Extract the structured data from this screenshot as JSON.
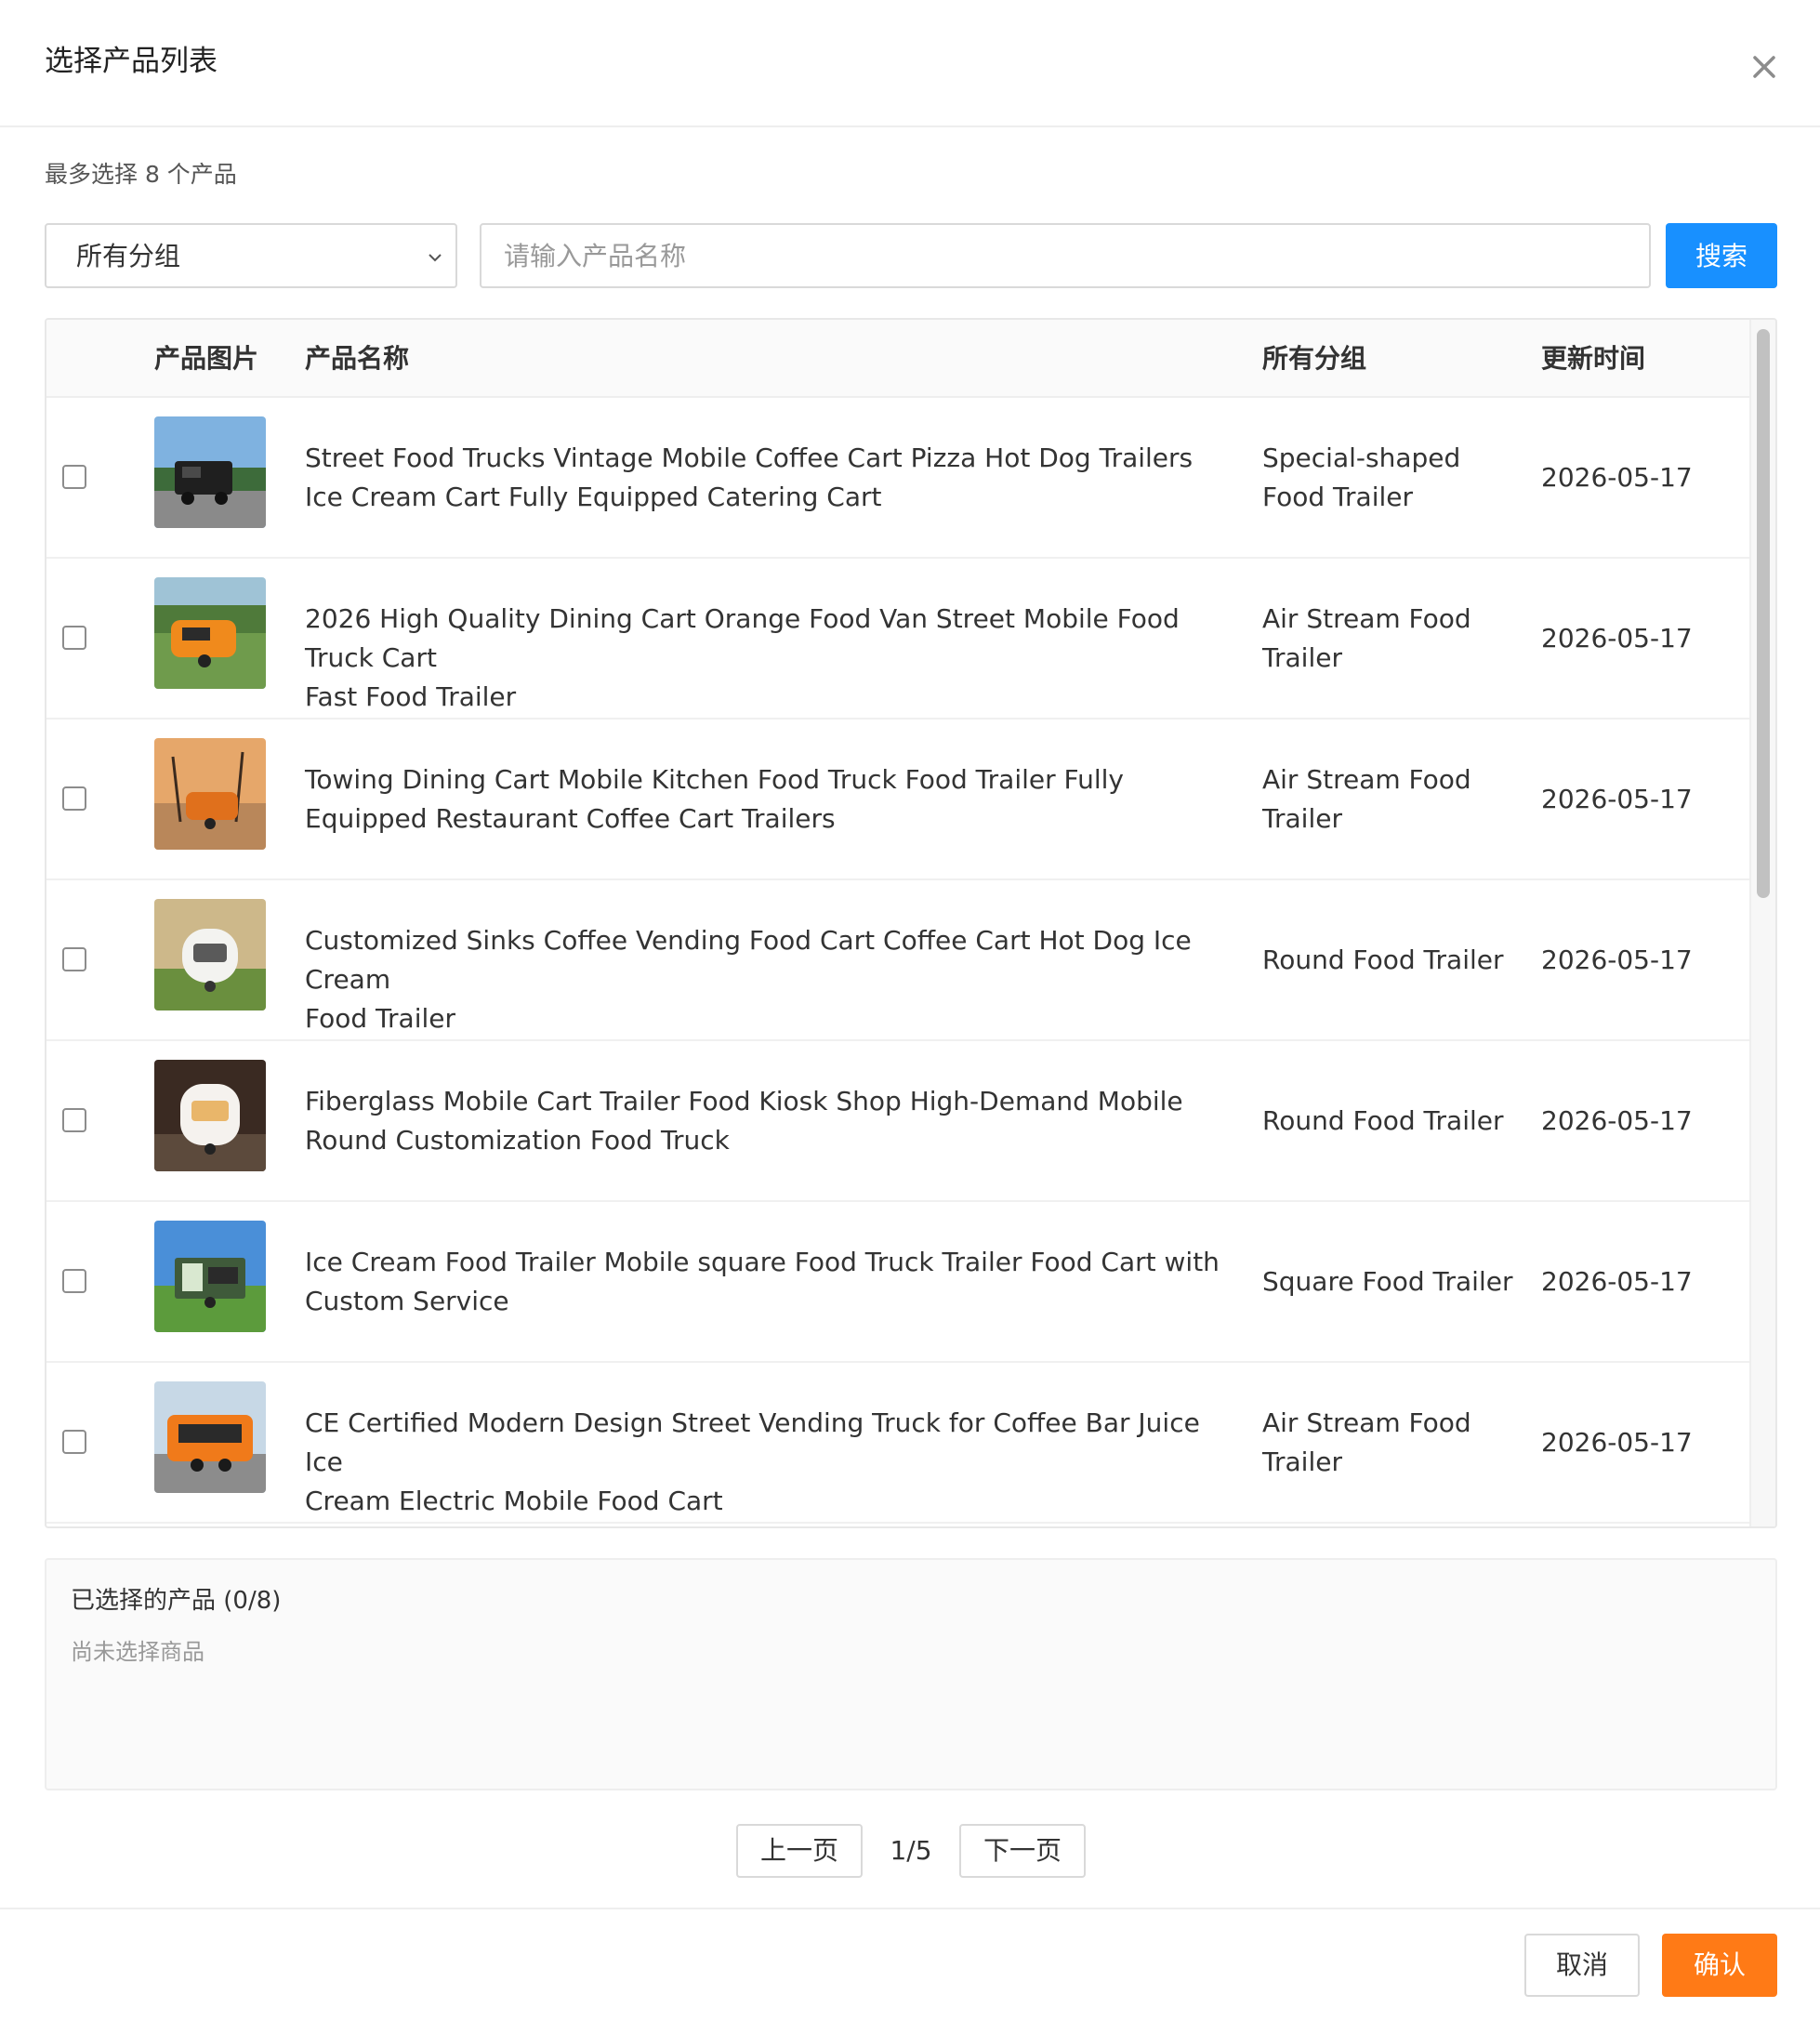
{
  "dialog": {
    "title": "选择产品列表",
    "max_hint": "最多选择 8 个产品"
  },
  "filters": {
    "group_value": "所有分组",
    "search_placeholder": "请输入产品名称",
    "search_label": "搜索"
  },
  "table": {
    "headers": {
      "image": "产品图片",
      "name": "产品名称",
      "group": "所有分组",
      "updated": "更新时间"
    },
    "rows": [
      {
        "name_lines": [
          "Street Food Trucks Vintage Mobile Coffee Cart Pizza Hot Dog Trailers",
          "Ice Cream Cart Fully Equipped Catering Cart"
        ],
        "group_lines": [
          "Special-shaped",
          "Food Trailer"
        ],
        "date": "2026-05-17",
        "thumb": "black-food-truck"
      },
      {
        "name_lines": [
          "2026 High Quality Dining Cart Orange Food Van Street Mobile Food Truck Cart",
          "Fast Food Trailer"
        ],
        "group_lines": [
          "Air Stream Food",
          "Trailer"
        ],
        "date": "2026-05-17",
        "thumb": "orange-trailer-lake"
      },
      {
        "name_lines": [
          "Towing Dining Cart Mobile Kitchen Food Truck Food Trailer Fully",
          "Equipped Restaurant Coffee Cart Trailers"
        ],
        "group_lines": [
          "Air Stream Food",
          "Trailer"
        ],
        "date": "2026-05-17",
        "thumb": "trailer-palm-sunset"
      },
      {
        "name_lines": [
          "Customized Sinks Coffee Vending Food Cart Coffee Cart Hot Dog Ice Cream",
          "Food Trailer"
        ],
        "group_lines": [
          "Round Food Trailer"
        ],
        "date": "2026-05-17",
        "thumb": "white-round-cart"
      },
      {
        "name_lines": [
          "Fiberglass Mobile Cart Trailer Food Kiosk Shop High-Demand Mobile",
          "Round Customization Food Truck"
        ],
        "group_lines": [
          "Round Food Trailer"
        ],
        "date": "2026-05-17",
        "thumb": "white-kiosk-night"
      },
      {
        "name_lines": [
          "Ice Cream Food Trailer Mobile square Food Truck Trailer Food Cart with",
          "Custom Service"
        ],
        "group_lines": [
          "Square Food Trailer"
        ],
        "date": "2026-05-17",
        "thumb": "green-square-trailer"
      },
      {
        "name_lines": [
          "CE Certified Modern Design Street Vending Truck for Coffee Bar Juice Ice",
          "Cream Electric Mobile Food Cart"
        ],
        "group_lines": [
          "Air Stream Food",
          "Trailer"
        ],
        "date": "2026-05-17",
        "thumb": "orange-vending-truck"
      }
    ]
  },
  "selected": {
    "title": "已选择的产品 (0/8)",
    "empty_text": "尚未选择商品"
  },
  "pagination": {
    "prev_label": "上一页",
    "indicator": "1/5",
    "next_label": "下一页"
  },
  "footer": {
    "cancel_label": "取消",
    "confirm_label": "确认"
  },
  "colors": {
    "primary": "#1890ff",
    "confirm": "#ff7a16"
  }
}
